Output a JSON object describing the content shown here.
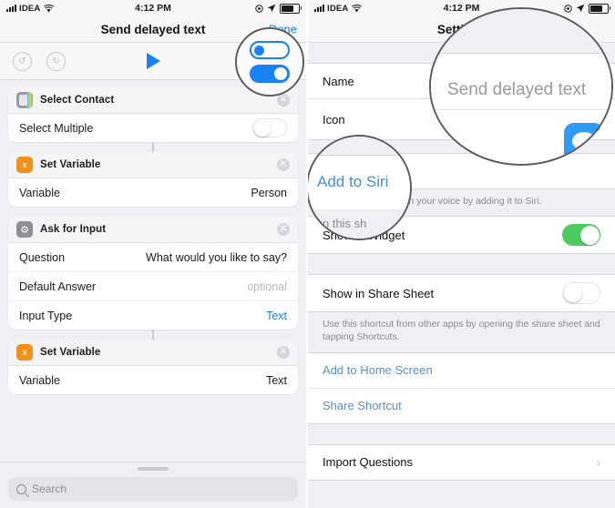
{
  "status_bar": {
    "carrier": "IDEA",
    "time": "4:12 PM",
    "signal_icon": "signal-bars-icon",
    "wifi_icon": "wifi-icon",
    "alarm_icon": "alarm-icon",
    "location_icon": "location-arrow-icon",
    "battery_icon": "battery-icon"
  },
  "left_screen": {
    "nav": {
      "title": "Send delayed text",
      "done_label": "Done"
    },
    "toolbar": {
      "undo_icon": "undo-icon",
      "redo_icon": "redo-icon",
      "play_icon": "play-icon",
      "share_icon": "share-icon",
      "settings_toggles_icon": "settings-toggles-icon"
    },
    "actions": [
      {
        "icon": "contacts-icon",
        "title": "Select Contact",
        "remove_icon": "remove-icon",
        "rows": [
          {
            "label": "Select Multiple",
            "control": "toggle",
            "value": "off"
          }
        ]
      },
      {
        "icon": "set-variable-icon",
        "icon_glyph": "x",
        "title": "Set Variable",
        "remove_icon": "remove-icon",
        "rows": [
          {
            "label": "Variable",
            "value": "Person",
            "style": "plain"
          }
        ]
      },
      {
        "icon": "gear-icon",
        "title": "Ask for Input",
        "remove_icon": "remove-icon",
        "rows": [
          {
            "label": "Question",
            "value": "What would you like to say?",
            "style": "plain"
          },
          {
            "label": "Default Answer",
            "value": "optional",
            "style": "muted"
          },
          {
            "label": "Input Type",
            "value": "Text",
            "style": "blue"
          }
        ]
      },
      {
        "icon": "set-variable-icon",
        "icon_glyph": "x",
        "title": "Set Variable",
        "remove_icon": "remove-icon",
        "rows": [
          {
            "label": "Variable",
            "value": "Text",
            "style": "plain"
          }
        ]
      }
    ],
    "drawer": {
      "grabber": "drag-handle",
      "search_placeholder": "Search",
      "search_icon": "search-icon"
    },
    "magnifier": {
      "target": "settings-toggles-icon",
      "switch_off_label": "",
      "switch_on_label": ""
    }
  },
  "right_screen": {
    "nav": {
      "title": "Settings"
    },
    "rows": {
      "name_label": "Name",
      "name_value": "Send delayed text",
      "icon_label": "Icon",
      "icon_value": "message-bubble-icon",
      "add_to_siri": "Add to Siri",
      "siri_note": "Run this shortcut with your voice by adding it to Siri.",
      "show_in_widget": "Show in Widget",
      "show_in_widget_state": "on",
      "show_in_share_sheet": "Show in Share Sheet",
      "show_in_share_sheet_state": "off",
      "share_sheet_note": "Use this shortcut from other apps by opening the share sheet and tapping Shortcuts.",
      "add_to_home_screen": "Add to Home Screen",
      "share_shortcut": "Share Shortcut",
      "import_questions": "Import Questions",
      "import_questions_chevron": "chevron-right-icon"
    },
    "magnifiers": {
      "name_zoom_text": "Send delayed text",
      "siri_zoom_text": "Add to Siri"
    }
  }
}
